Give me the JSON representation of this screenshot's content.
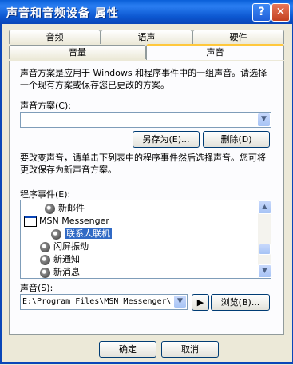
{
  "window": {
    "title": "声音和音频设备 属性",
    "help_glyph": "?",
    "close_glyph": "✕"
  },
  "tabs": [
    {
      "label": "音频"
    },
    {
      "label": "语声"
    },
    {
      "label": "硬件"
    },
    {
      "label": "音量"
    },
    {
      "label": "声音"
    }
  ],
  "sounds": {
    "intro": "声音方案是应用于 Windows 和程序事件中的一组声音。请选择一个现有方案或保存您已更改的方案。",
    "scheme_label": "声音方案(C):",
    "scheme_value": "",
    "save_as_label": "另存为(E)...",
    "delete_label": "删除(D)",
    "instructions": "要改变声音，请单击下列表中的程序事件然后选择声音。您可将更改保存为新声音方案。",
    "events_label": "程序事件(E):",
    "events": [
      {
        "label": "新邮件",
        "icon": "speaker-icon"
      },
      {
        "label": "MSN Messenger",
        "icon": "window-icon"
      },
      {
        "label": "联系人联机",
        "icon": "speaker-icon",
        "selected": true
      },
      {
        "label": "闪屏振动",
        "icon": "speaker-icon"
      },
      {
        "label": "新通知",
        "icon": "speaker-icon"
      },
      {
        "label": "新消息",
        "icon": "speaker-icon"
      }
    ],
    "sound_label": "声音(S):",
    "sound_value": "E:\\Program Files\\MSN Messenger\\",
    "play_glyph": "▶",
    "browse_label": "浏览(B)..."
  },
  "footer": {
    "ok_label": "确定",
    "cancel_label": "取消"
  }
}
